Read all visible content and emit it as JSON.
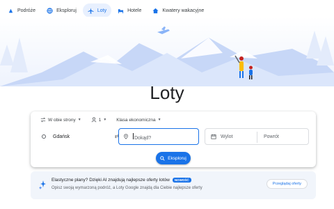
{
  "nav": {
    "items": [
      {
        "label": "Podróże",
        "icon": "travel-explore-icon",
        "active": false
      },
      {
        "label": "Eksploruj",
        "icon": "globe-icon",
        "active": false
      },
      {
        "label": "Loty",
        "icon": "airplane-icon",
        "active": true
      },
      {
        "label": "Hotele",
        "icon": "bed-icon",
        "active": false
      },
      {
        "label": "Kwatery wakacyjne",
        "icon": "house-icon",
        "active": false
      }
    ]
  },
  "page": {
    "title": "Loty"
  },
  "search": {
    "trip_type": "W obie strony",
    "passengers": "1",
    "cabin_class": "Klasa ekonomiczna",
    "from_value": "Gdańsk",
    "to_placeholder": "Dokąd?",
    "depart_placeholder": "Wylot",
    "return_placeholder": "Powrót",
    "explore_label": "Eksploruj"
  },
  "promo": {
    "title": "Elastyczne plany? Dzięki AI znajdują najlepsze oferty lotów",
    "badge": "NOWOŚĆ",
    "subtitle": "Opisz swoją wymarzoną podróż, a Loty Google znajdą dla Ciebie najlepsze oferty",
    "button_label": "Przeglądaj oferty"
  },
  "colors": {
    "accent": "#1a73e8",
    "active_chip_bg": "#e8f0fe",
    "promo_bg": "#f1f5fb",
    "hero_sky": "#c7d7f7"
  }
}
